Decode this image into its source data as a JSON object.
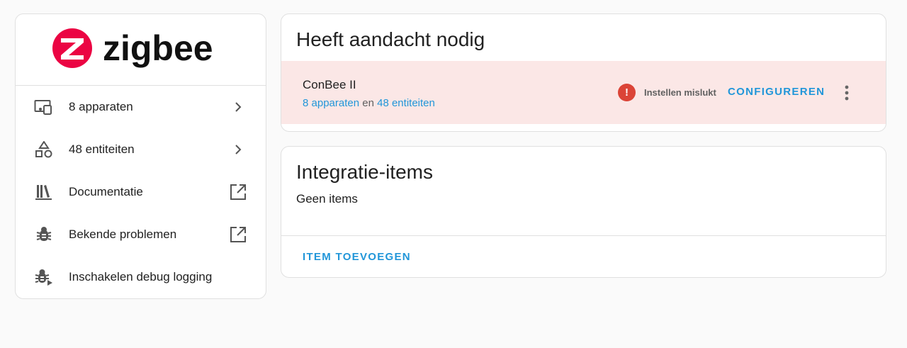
{
  "brand": {
    "name": "zigbee",
    "logo_color": "#eb0443"
  },
  "sidebar": {
    "items": [
      {
        "label": "8 apparaten",
        "icon": "devices-icon",
        "trail": "chevron-right-icon"
      },
      {
        "label": "48 entiteiten",
        "icon": "shapes-icon",
        "trail": "chevron-right-icon"
      },
      {
        "label": "Documentatie",
        "icon": "bookshelf-icon",
        "trail": "open-in-new-icon"
      },
      {
        "label": "Bekende problemen",
        "icon": "bug-icon",
        "trail": "open-in-new-icon"
      },
      {
        "label": "Inschakelen debug logging",
        "icon": "bug-play-icon",
        "trail": ""
      }
    ]
  },
  "attention": {
    "title": "Heeft aandacht nodig",
    "device": {
      "name": "ConBee II",
      "devices_link": "8 apparaten",
      "conjunction": "en",
      "entities_link": "48 entiteiten",
      "status_text": "Instellen mislukt",
      "configure_label": "CONFIGUREREN"
    }
  },
  "integration_items": {
    "title": "Integratie-items",
    "empty_text": "Geen items",
    "add_label": "ITEM TOEVOEGEN"
  },
  "colors": {
    "accent": "#2196d9",
    "error": "#db4437",
    "attention_bg": "#fbe7e6"
  }
}
